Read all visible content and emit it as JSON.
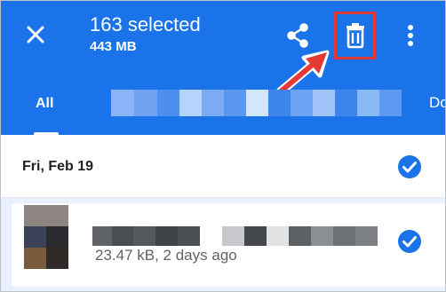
{
  "header": {
    "title": "163 selected",
    "subtitle": "443 MB",
    "icons": [
      "close-icon",
      "share-icon",
      "trash-icon",
      "more-vert-icon"
    ],
    "accent_color": "#1a73e8",
    "highlight_color": "#e53935"
  },
  "tabs": {
    "active": "All",
    "partial_next": "Do"
  },
  "section": {
    "date": "Fri, Feb 19"
  },
  "file": {
    "meta": "23.47 kB, 2 days ago",
    "selected": true
  }
}
